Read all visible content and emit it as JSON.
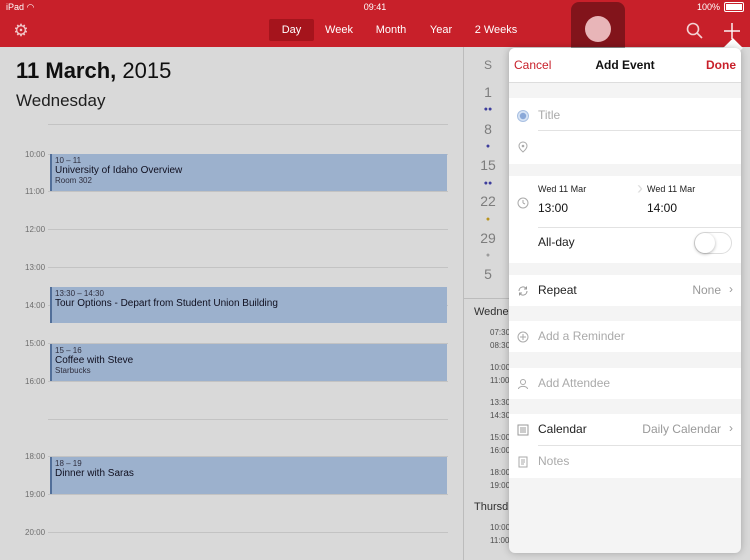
{
  "status": {
    "time": "09:41",
    "battery": "100%"
  },
  "nav": {
    "segments": [
      "Day",
      "Week",
      "Month",
      "Year",
      "2 Weeks"
    ],
    "active": "Day"
  },
  "day": {
    "date_bold": "11 March,",
    "year": "2015",
    "weekday": "Wednesday"
  },
  "hours": [
    "10:00",
    "11:00",
    "12:00",
    "13:00",
    "14:00",
    "15:00",
    "16:00",
    "18:00",
    "19:00",
    "20:00"
  ],
  "events": [
    {
      "time": "10 – 11",
      "name": "University of Idaho Overview",
      "sub": "Room 302"
    },
    {
      "time": "13:30 – 14:30",
      "name": "Tour Options - Depart from Student Union Building",
      "sub": ""
    },
    {
      "time": "15 – 16",
      "name": "Coffee with Steve",
      "sub": "Starbucks"
    },
    {
      "time": "18 – 19",
      "name": "Dinner with Saras",
      "sub": ""
    }
  ],
  "mini_month": {
    "header": "S",
    "days": [
      "1",
      "8",
      "15",
      "22",
      "29",
      "5"
    ]
  },
  "list": {
    "head1": "Wedne",
    "times1": [
      "07:30",
      "08:30",
      "10:00",
      "11:00",
      "13:30",
      "14:30",
      "15:00",
      "16:00",
      "18:00",
      "19:00"
    ],
    "head2": "Thursd",
    "times2": [
      "10:00",
      "11:00"
    ]
  },
  "popover": {
    "cancel": "Cancel",
    "title": "Add Event",
    "done": "Done",
    "title_placeholder": "Title",
    "start_date": "Wed 11 Mar",
    "start_time": "13:00",
    "end_date": "Wed 11 Mar",
    "end_time": "14:00",
    "allday": "All-day",
    "repeat": "Repeat",
    "repeat_value": "None",
    "reminder": "Add a Reminder",
    "attendee": "Add Attendee",
    "calendar": "Calendar",
    "calendar_value": "Daily Calendar",
    "notes": "Notes"
  }
}
